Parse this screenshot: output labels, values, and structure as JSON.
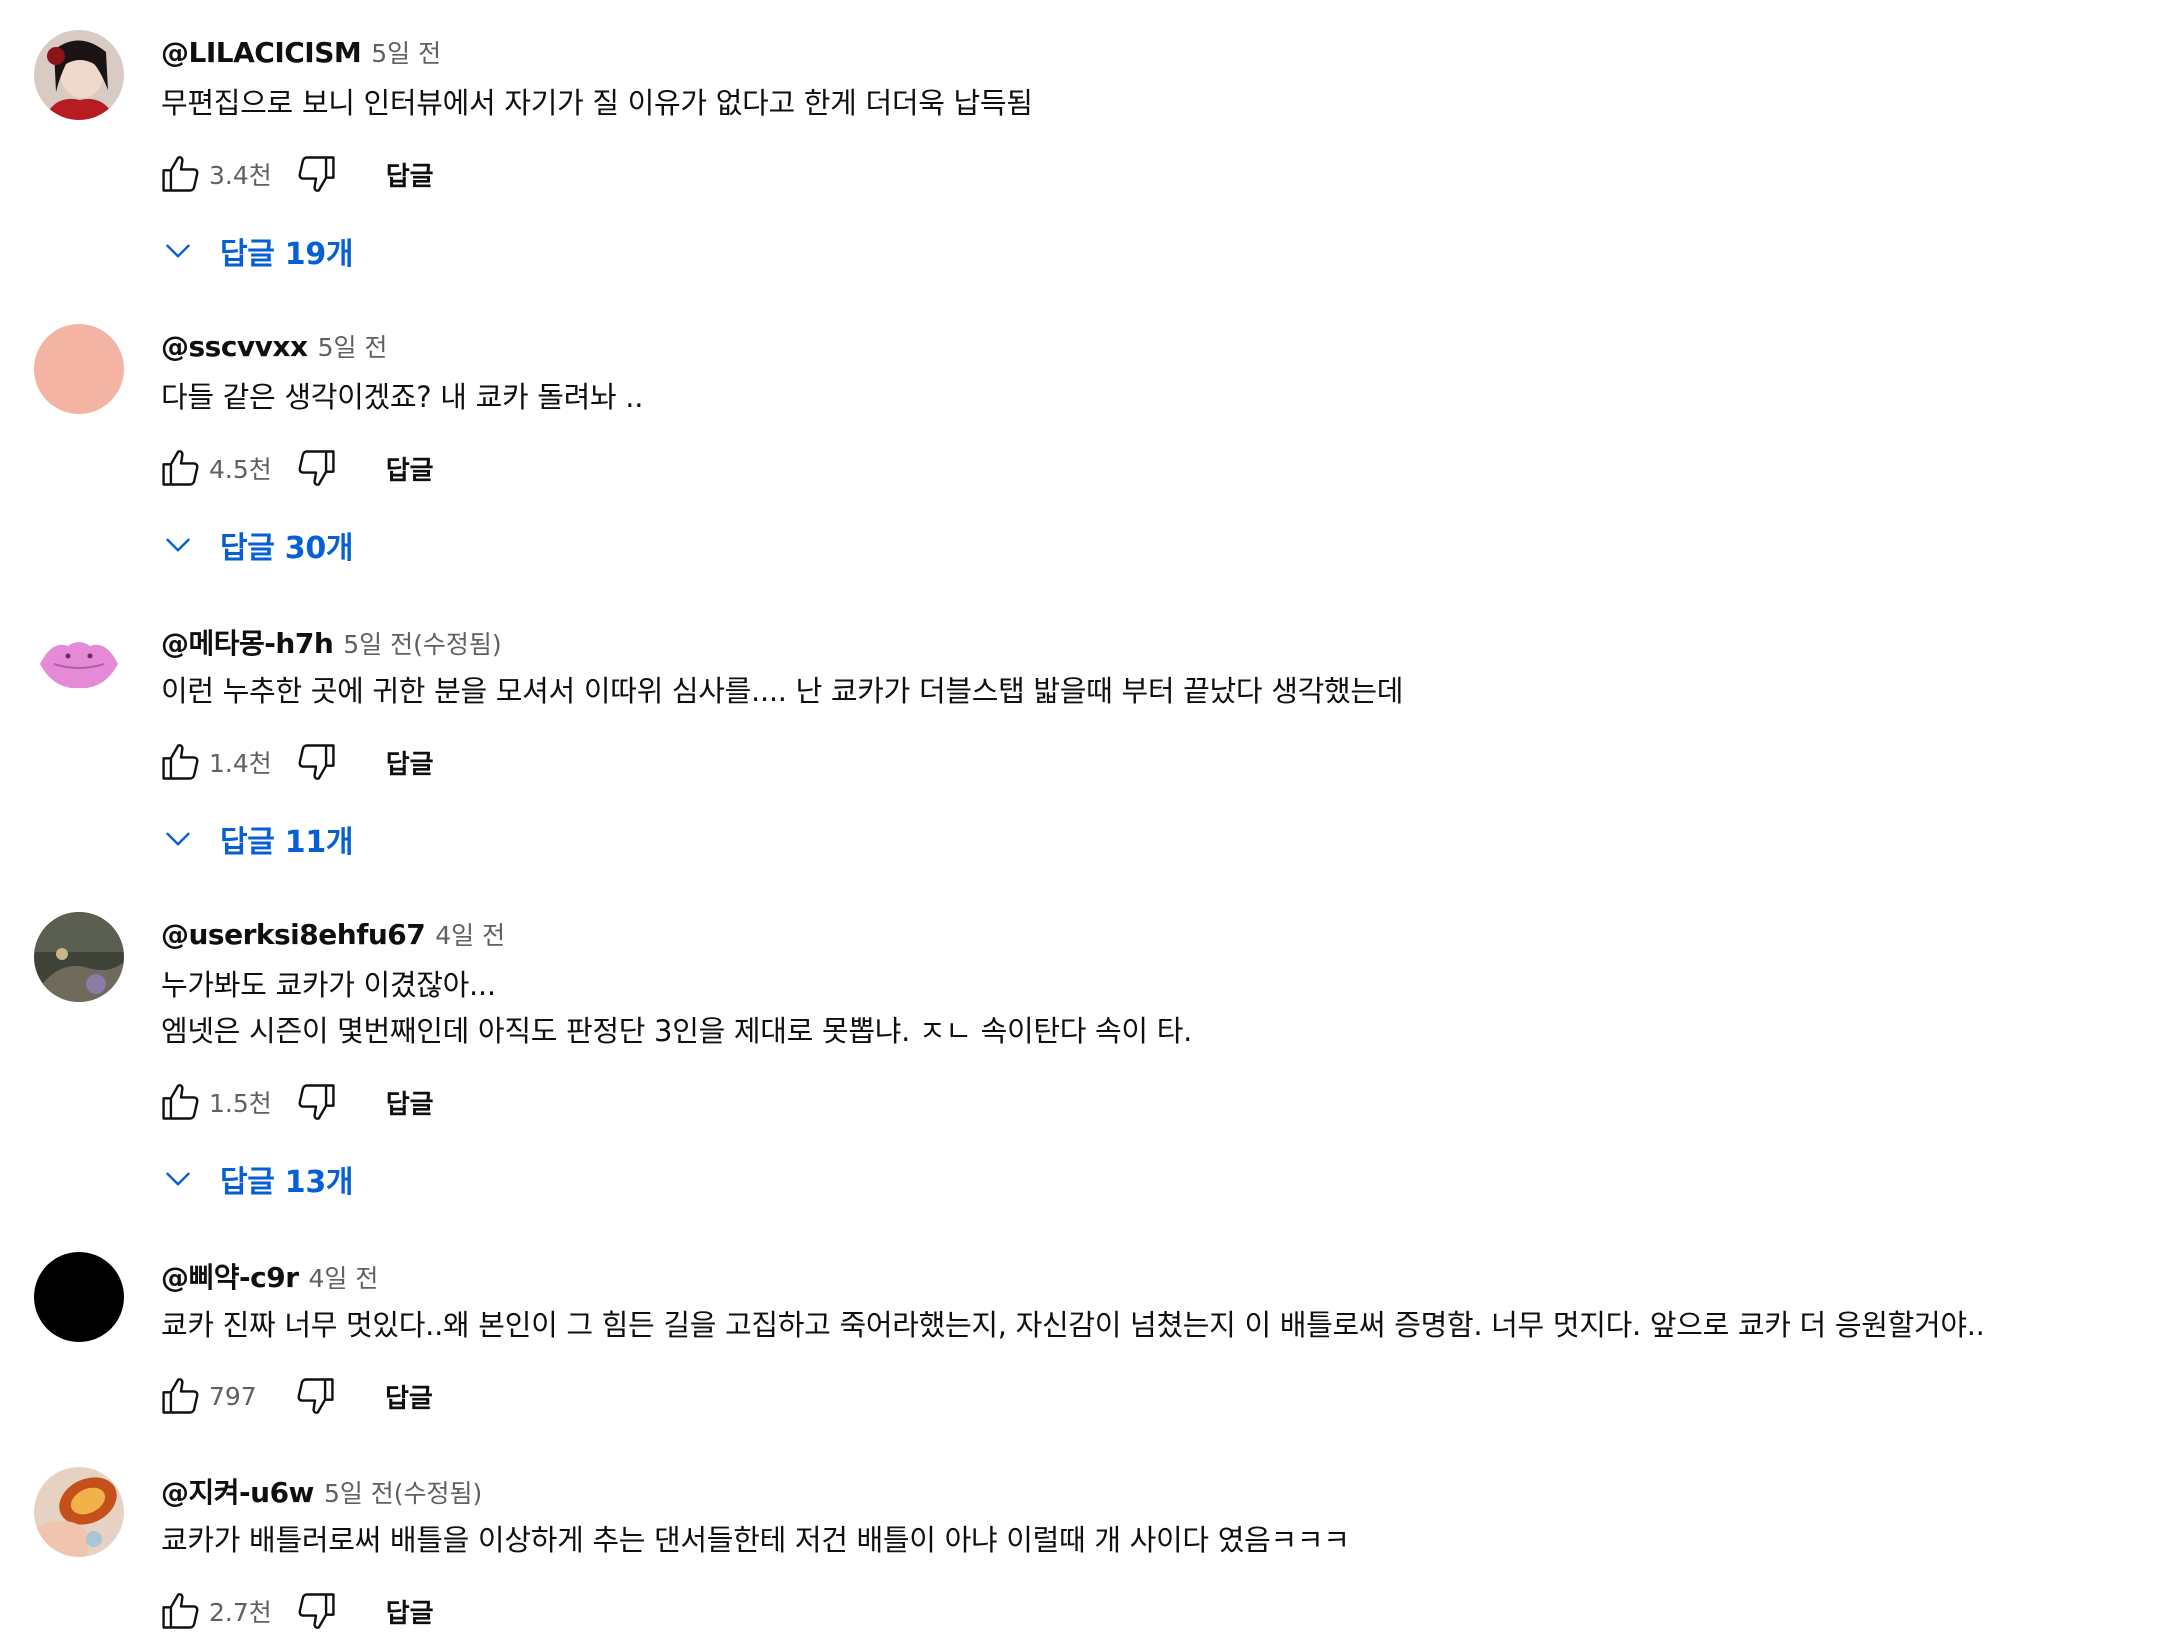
{
  "icons": {
    "like": "thumb-up-outline",
    "dislike": "thumb-down-outline",
    "expand": "chevron-down",
    "accent": "#065fd4"
  },
  "comments": [
    {
      "author": "@LILACICISM",
      "time": "5일 전",
      "lines": [
        "무편집으로 보니 인터뷰에서 자기가 질 이유가 없다고 한게 더더욱 납득됨"
      ],
      "likes": "3.4천",
      "reply_label": "답글",
      "replies": "답글 19개"
    },
    {
      "author": "@sscvvxx",
      "time": "5일 전",
      "lines": [
        "다들 같은 생각이겠죠? 내 쿄카 돌려놔 .."
      ],
      "likes": "4.5천",
      "reply_label": "답글",
      "replies": "답글 30개"
    },
    {
      "author": "@메타몽-h7h",
      "time": "5일 전(수정됨)",
      "lines": [
        "이런 누추한 곳에 귀한 분을 모셔서 이따위 심사를.... 난 쿄카가 더블스탭 밟을때 부터 끝났다 생각했는데"
      ],
      "likes": "1.4천",
      "reply_label": "답글",
      "replies": "답글 11개"
    },
    {
      "author": "@userksi8ehfu67",
      "time": "4일 전",
      "lines": [
        "누가봐도 쿄카가 이겼잖아...",
        "엠넷은 시즌이 몇번째인데 아직도 판정단 3인을 제대로 못뽑냐. ㅈㄴ 속이탄다 속이 타."
      ],
      "likes": "1.5천",
      "reply_label": "답글",
      "replies": "답글 13개"
    },
    {
      "author": "@삐약-c9r",
      "time": "4일 전",
      "lines": [
        "쿄카 진짜 너무 멋있다..왜 본인이 그 힘든 길을 고집하고 죽어라했는지, 자신감이 넘쳤는지 이 배틀로써 증명함. 너무 멋지다. 앞으로 쿄카 더 응원할거야.."
      ],
      "likes": "797",
      "reply_label": "답글"
    },
    {
      "author": "@지켜-u6w",
      "time": "5일 전(수정됨)",
      "lines": [
        "쿄카가 배틀러로써 배틀을 이상하게 추는 댄서들한테 저건 배틀이 아냐 이럴때 개 사이다 였음ㅋㅋㅋ"
      ],
      "likes": "2.7천",
      "reply_label": "답글"
    }
  ]
}
